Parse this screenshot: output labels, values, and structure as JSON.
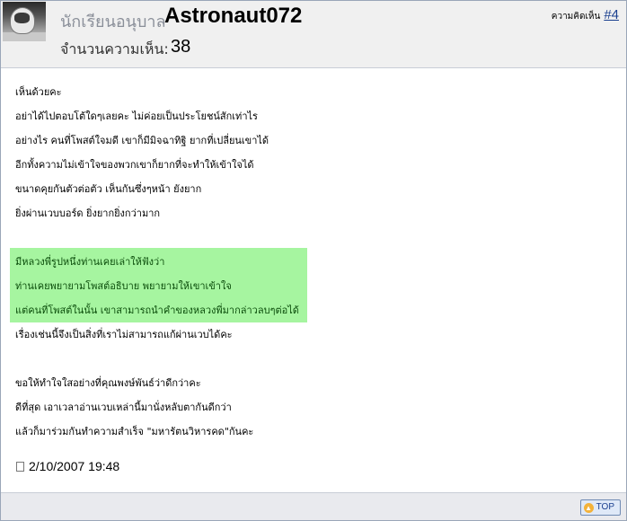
{
  "header": {
    "rank": "นักเรียนอนุบาล",
    "username": "Astronaut072",
    "post_count_label": "จำนวนความเห็น:",
    "post_count": "38",
    "comment_label": "ความคิดเห็น",
    "comment_number": "#4"
  },
  "post": {
    "lines": [
      "เห็นด้วยคะ",
      "อย่าได้ไปตอบโต้ใดๆเลยคะ ไม่ค่อยเป็นประโยชน์สักเท่าไร",
      "อย่างไร คนที่โพสต์ใจมดี เขาก็มีมิจฉาทิฐิ ยากที่เปลี่ยนเขาได้",
      "อีกทั้งความไม่เข้าใจของพวกเขาก็ยากที่จะทำให้เข้าใจได้",
      "ขนาดคุยกันตัวต่อตัว เห็นกันซึ่งๆหน้า ยังยาก",
      "ยิ่งผ่านเวบบอร์ด ยิ่งยากยิ่งกว่ามาก"
    ],
    "highlight_lines": [
      "มีหลวงพี่รูปหนึ่งท่านเคยเล่าให้ฟังว่า",
      "ท่านเคยพยายามโพสต์อธิบาย พยายามให้เขาเข้าใจ",
      "แต่คนที่โพสต์ในนั้น เขาสามารถนำคำของหลวงพี่มากล่าวลบๆต่อได้"
    ],
    "after_highlight": "เรื่องเช่นนี้จึงเป็นสิ่งที่เราไม่สามารถแก้ผ่านเวบได้คะ",
    "closing_lines": [
      "ขอให้ทำใจใสอย่างที่คุณพงษ์พันธ์ว่าดีกว่าคะ",
      "ดีที่สุด เอาเวลาอ่านเวบเหล่านี้มานั่งหลับตากันดีกว่า",
      "แล้วก็มาร่วมกันทำความสำเร็จ \"มหารัตนวิหารคด\"กันคะ"
    ],
    "date": "2/10/2007 19:48"
  },
  "footer": {
    "top_label": "TOP",
    "top_icon": "up-arrow-icon",
    "accent": "#f3b23a"
  },
  "colors": {
    "highlight": "#a6f5a0",
    "link": "#1a3f8f"
  }
}
